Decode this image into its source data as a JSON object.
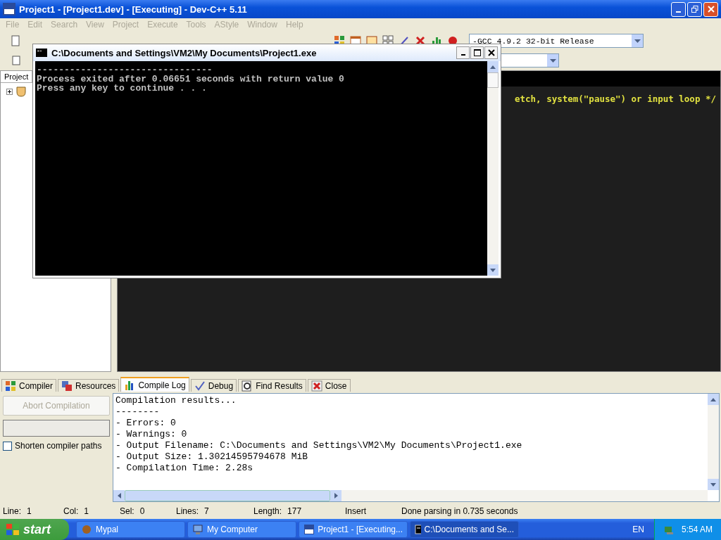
{
  "window": {
    "title": "Project1 - [Project1.dev] - [Executing] - Dev-C++ 5.11"
  },
  "menu": [
    {
      "label": "File",
      "disabled": true
    },
    {
      "label": "Edit",
      "disabled": true
    },
    {
      "label": "Search",
      "disabled": true
    },
    {
      "label": "View",
      "disabled": true
    },
    {
      "label": "Project",
      "disabled": true
    },
    {
      "label": "Execute",
      "disabled": true
    },
    {
      "label": "Tools",
      "disabled": true
    },
    {
      "label": "AStyle",
      "disabled": true
    },
    {
      "label": "Window",
      "disabled": true
    },
    {
      "label": "Help",
      "disabled": true
    }
  ],
  "compiler_select": {
    "value": "-GCC 4.9.2 32-bit Release"
  },
  "project_panel": {
    "tab": "Project",
    "tree": [
      {
        "expanded": false
      }
    ]
  },
  "editor": {
    "visible_line": "etch, system(\"pause\") or input loop */"
  },
  "console": {
    "title": "C:\\Documents and Settings\\VM2\\My Documents\\Project1.exe",
    "lines": [
      "--------------------------------",
      "Process exited after 0.06651 seconds with return value 0",
      "Press any key to continue . . ."
    ]
  },
  "bottom_tabs": [
    {
      "label": "Compiler",
      "selected": false
    },
    {
      "label": "Resources",
      "selected": false
    },
    {
      "label": "Compile Log",
      "selected": true
    },
    {
      "label": "Debug",
      "selected": false
    },
    {
      "label": "Find Results",
      "selected": false
    },
    {
      "label": "Close",
      "selected": false
    }
  ],
  "compile_panel": {
    "abort_button": {
      "label": "Abort Compilation",
      "disabled": true
    },
    "progress": {
      "level": 0
    },
    "shorten_paths": {
      "label": "Shorten compiler paths",
      "checked": false
    }
  },
  "compile_log": [
    "Compilation results...",
    "--------",
    "- Errors: 0",
    "- Warnings: 0",
    "- Output Filename: C:\\Documents and Settings\\VM2\\My Documents\\Project1.exe",
    "- Output Size: 1.30214595794678 MiB",
    "- Compilation Time: 2.28s"
  ],
  "status_bar": [
    {
      "label": "Line:",
      "value": "1"
    },
    {
      "label": "Col:",
      "value": "1"
    },
    {
      "label": "Sel:",
      "value": "0"
    },
    {
      "label": "Lines:",
      "value": "7"
    },
    {
      "label": "Length:",
      "value": "177"
    },
    {
      "value": "Insert"
    },
    {
      "value": "Done parsing in 0.735 seconds"
    }
  ],
  "taskbar": {
    "start": "start",
    "items": [
      {
        "label": "Mypal",
        "selected": false
      },
      {
        "label": "My Computer",
        "selected": false
      },
      {
        "label": "Project1 - [Executing...",
        "selected": false
      },
      {
        "label": "C:\\Documents and Se...",
        "selected": true
      }
    ],
    "language": "EN",
    "clock": "5:54 AM"
  }
}
